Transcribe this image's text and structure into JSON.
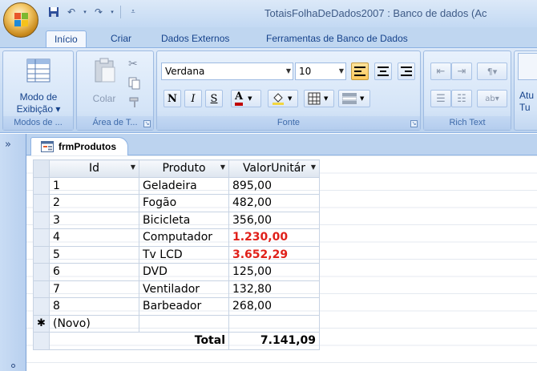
{
  "window": {
    "title": "TotaisFolhaDeDados2007 : Banco de dados (Ac"
  },
  "tabs": [
    "Início",
    "Criar",
    "Dados Externos",
    "Ferramentas de Banco de Dados"
  ],
  "ribbon": {
    "view_button": {
      "line1": "Modo de",
      "line2": "Exibição ▾"
    },
    "view_group_label": "Modos de ...",
    "paste_label": "Colar",
    "clipboard_group_label": "Área de T...",
    "font_name": "Verdana",
    "font_size": "10",
    "bold": "N",
    "italic": "I",
    "underline": "S",
    "font_color": "A",
    "font_group_label": "Fonte",
    "richtext_group_label": "Rich Text",
    "cutoff_label_1": "Atu",
    "cutoff_label_2": "Tu"
  },
  "document": {
    "tab_label": "frmProdutos"
  },
  "datasheet": {
    "columns": [
      "Id",
      "Produto",
      "ValorUnitár"
    ],
    "rows": [
      {
        "id": "1",
        "produto": "Geladeira",
        "valor": "895,00",
        "highlight": false
      },
      {
        "id": "2",
        "produto": "Fogão",
        "valor": "482,00",
        "highlight": false
      },
      {
        "id": "3",
        "produto": "Bicicleta",
        "valor": "356,00",
        "highlight": false
      },
      {
        "id": "4",
        "produto": "Computador",
        "valor": "1.230,00",
        "highlight": true
      },
      {
        "id": "5",
        "produto": "Tv LCD",
        "valor": "3.652,29",
        "highlight": true
      },
      {
        "id": "6",
        "produto": "DVD",
        "valor": "125,00",
        "highlight": false
      },
      {
        "id": "7",
        "produto": "Ventilador",
        "valor": "132,80",
        "highlight": false
      },
      {
        "id": "8",
        "produto": "Barbeador",
        "valor": "268,00",
        "highlight": false
      }
    ],
    "new_row_label": "(Novo)",
    "new_row_marker": "✱",
    "total_label": "Total",
    "total_value": "7.141,09"
  },
  "colors": {
    "highlight": "#e0201a",
    "accent": "#15428b"
  }
}
